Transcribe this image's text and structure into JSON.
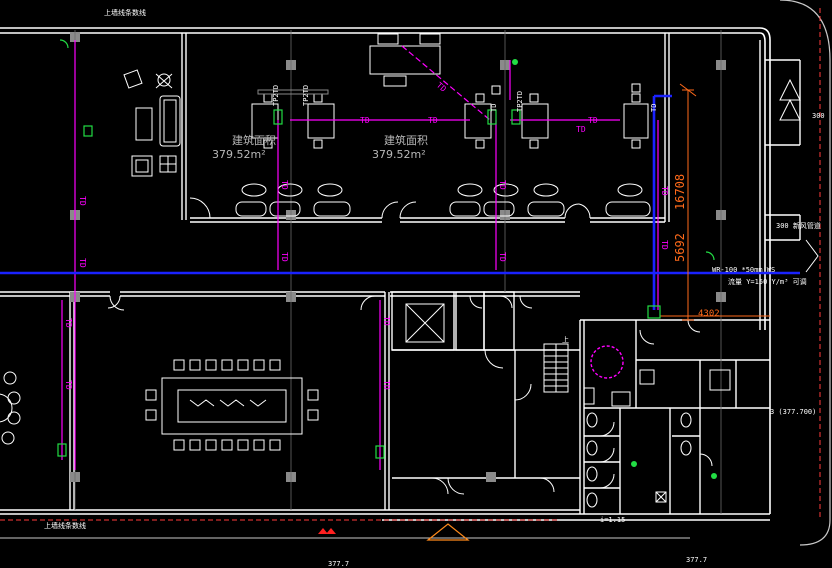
{
  "rooms": {
    "left_area_label": "建筑面积",
    "left_area_value": "379.52m²",
    "right_area_label": "建筑面积",
    "right_area_value": "379.52m²"
  },
  "pipes": {
    "td": "TD",
    "tp2td": "TP2TD",
    "tp2td_alt": "TP2TD",
    "td_vertical": "TD",
    "wr_spec": "WR-100 *50mm WS",
    "valve_spec": "流量 Y=150 Y/m³ 可调"
  },
  "dimensions": {
    "orange_main": "5692",
    "orange_total": "16708",
    "orange_small": "4302",
    "elevation_right": "3 (377.700)",
    "grid_bottom_left": "377.7",
    "grid_bottom_right": "377.7",
    "floor_level": "i=1.15"
  },
  "labels": {
    "top_note": "上墙线条数线",
    "bottom_note": "上墙线条数线",
    "note_300_top": "300",
    "note_300_mid": "300 新风管道",
    "stair": "上",
    "colors": {
      "background": "#000000",
      "wall": "#ffffff",
      "grid": "#9a9a9a",
      "magenta": "#ff00ff",
      "blue": "#1a22ff",
      "orange": "#ff6a1a",
      "green": "#22dd44",
      "red": "#ff2020"
    }
  }
}
